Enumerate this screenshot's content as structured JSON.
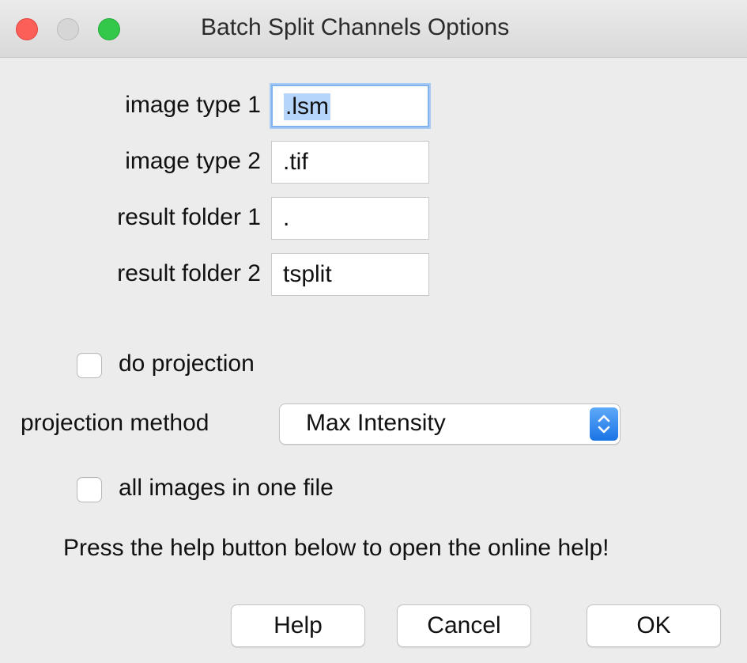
{
  "window": {
    "title": "Batch Split Channels Options"
  },
  "fields": [
    {
      "label": "image type 1",
      "value": ".lsm"
    },
    {
      "label": "image type 2",
      "value": ".tif"
    },
    {
      "label": "result folder 1",
      "value": "."
    },
    {
      "label": "result folder 2",
      "value": "tsplit"
    }
  ],
  "do_projection": {
    "label": "do projection",
    "checked": false
  },
  "projection_method": {
    "label": "projection method",
    "selected": "Max Intensity"
  },
  "all_images": {
    "label": "all images in one file",
    "checked": false
  },
  "help_message": "Press the help button below to open the online help!",
  "buttons": {
    "help": "Help",
    "cancel": "Cancel",
    "ok": "OK"
  },
  "colors": {
    "close": "#fc5f57",
    "minimize": "#d6d6d6",
    "zoom": "#34c84a",
    "focus_ring": "#7fb2ee",
    "selection": "#b5d5fb",
    "popup_accent": "#1b74e6"
  }
}
